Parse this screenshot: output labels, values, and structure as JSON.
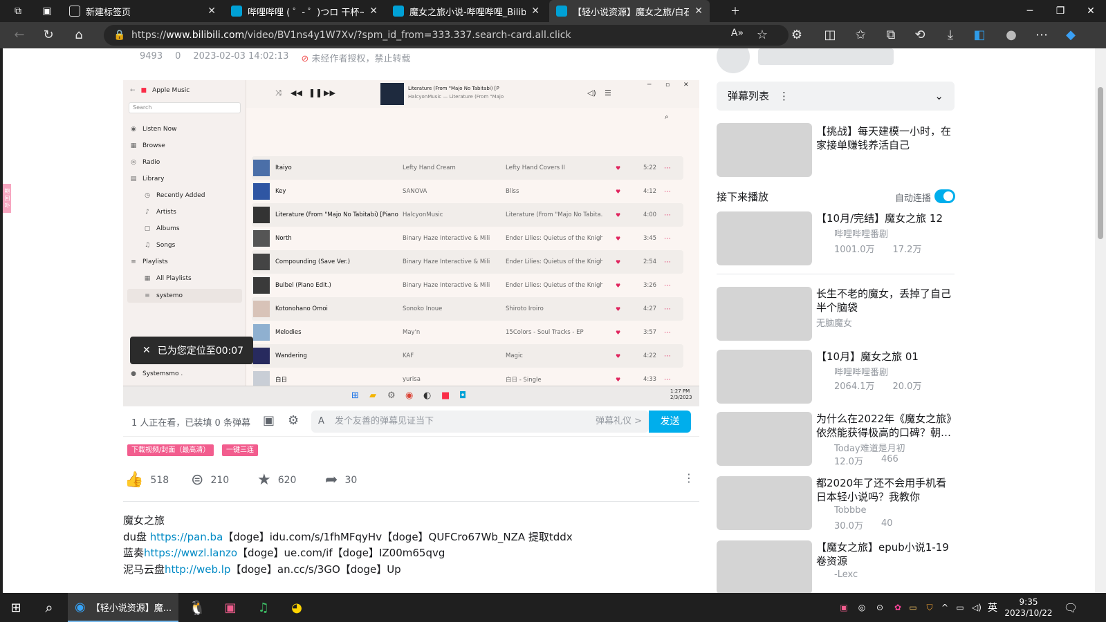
{
  "browser": {
    "tabs": [
      {
        "label": "新建标签页"
      },
      {
        "label": "哔哩哔哩 ( ゜- ゜)つロ 干杯~-bilibili"
      },
      {
        "label": "魔女之旅小说-哔哩哔哩_Bilibili"
      },
      {
        "label": "【轻小说资源】魔女之旅/白石定..."
      }
    ],
    "url_prefix": "https://",
    "url_domain": "www.bilibili.com",
    "url_path": "/video/BV1ns4y1W7Xv/?spm_id_from=333.337.search-card.all.click"
  },
  "video_meta": {
    "views": "9493",
    "danmaku": "0",
    "date": "2023-02-03 14:02:13",
    "rights": "未经作者授权，禁止转载"
  },
  "apple_music": {
    "app_name": "Apple Music",
    "search_placeholder": "Search",
    "nav": [
      "Listen Now",
      "Browse",
      "Radio",
      "Library",
      "Recently Added",
      "Artists",
      "Albums",
      "Songs",
      "Playlists",
      "All Playlists",
      "systemo"
    ],
    "user": "Systemsmo .",
    "now_playing_title": "Literature (From \"Majo No Tabitabi) [P",
    "now_playing_sub": "HalcyonMusic — Literature (From \"Majo",
    "songs": [
      {
        "t": "Itaiyo",
        "a": "Lefty Hand Cream",
        "al": "Lefty Hand Covers II",
        "d": "5:22"
      },
      {
        "t": "Key",
        "a": "SANOVA",
        "al": "Bliss",
        "d": "4:12"
      },
      {
        "t": "Literature (From \"Majo No Tabitabi) [Piano Arra",
        "a": "HalcyonMusic",
        "al": "Literature (From \"Majo No Tabita...",
        "d": "4:00"
      },
      {
        "t": "North",
        "a": "Binary Haze Interactive & Mili",
        "al": "Ender Lilies: Quietus of the Knigh...",
        "d": "3:45"
      },
      {
        "t": "Compounding (Save Ver.)",
        "a": "Binary Haze Interactive & Mili",
        "al": "Ender Lilies: Quietus of the Knigh...",
        "d": "2:54"
      },
      {
        "t": "Bulbel (Piano Edit.)",
        "a": "Binary Haze Interactive & Mili",
        "al": "Ender Lilies: Quietus of the Knigh...",
        "d": "3:26"
      },
      {
        "t": "Kotonohano Omoi",
        "a": "Sonoko Inoue",
        "al": "Shiroto Iroiro",
        "d": "4:27"
      },
      {
        "t": "Melodies",
        "a": "May'n",
        "al": "15Colors - Soul Tracks - EP",
        "d": "3:57"
      },
      {
        "t": "Wandering",
        "a": "KAF",
        "al": "Magic",
        "d": "4:22"
      },
      {
        "t": "白日",
        "a": "yurisa",
        "al": "白日 - Single",
        "d": "4:33"
      }
    ],
    "clock_time": "1:27 PM",
    "clock_date": "2/3/2023"
  },
  "toast": "已为您定位至00:07",
  "danmaku_bar": {
    "viewers": "1 人正在看，已装填 0 条弹幕",
    "placeholder": "发个友善的弹幕见证当下",
    "etiquette": "弹幕礼仪 >",
    "send": "发送"
  },
  "tags": [
    "下载视频/封面（最高清）",
    "一键三连"
  ],
  "actions": {
    "like": "518",
    "coin": "210",
    "fav": "620",
    "share": "30"
  },
  "description": [
    {
      "pre": "魔女之旅",
      "link": "",
      "post": ""
    },
    {
      "pre": "du盘 ",
      "link": "https://pan.ba",
      "post": "【doge】idu.com/s/1fhMFqyHv【doge】QUFCro67Wb_NZA 提取tddx"
    },
    {
      "pre": "蓝奏",
      "link": "https://wwzl.lanzo",
      "post": "【doge】ue.com/if【doge】IZ00m65qvg"
    },
    {
      "pre": "泥马云盘",
      "link": "http://web.lp",
      "post": "【doge】an.cc/s/3GO【doge】Up"
    }
  ],
  "right": {
    "danmaku_list": "弹幕列表",
    "up_next": "接下来播放",
    "autoplay": "自动连播",
    "cards": [
      {
        "title": "【挑战】每天建模一小时，在家接单赚钱养活自己",
        "up": "",
        "views": "",
        "dm": ""
      },
      {
        "title": "【10月/完结】魔女之旅 12",
        "up": "哔哩哔哩番剧",
        "views": "1001.0万",
        "dm": "17.2万"
      },
      {
        "title": "长生不老的魔女，丢掉了自己半个脑袋",
        "up": "无脑魔女",
        "views": "",
        "dm": ""
      },
      {
        "title": "【10月】魔女之旅 01",
        "up": "哔哩哔哩番剧",
        "views": "2064.1万",
        "dm": "20.0万"
      },
      {
        "title": "为什么在2022年《魔女之旅》依然能获得极高的口碑？朝…",
        "up": "Today难道是月初",
        "views": "12.0万",
        "dm": "466"
      },
      {
        "title": "都2020年了还不会用手机看日本轻小说吗？我教你",
        "up": "Tobbbe",
        "views": "30.0万",
        "dm": "40"
      },
      {
        "title": "【魔女之旅】epub小说1-19卷资源",
        "up": "-Lexc",
        "views": "",
        "dm": ""
      }
    ]
  },
  "side_float": "鲍 回 卟",
  "taskbar": {
    "active_window": "【轻小说资源】魔...",
    "time": "9:35",
    "date": "2023/10/22",
    "ime": "英"
  }
}
